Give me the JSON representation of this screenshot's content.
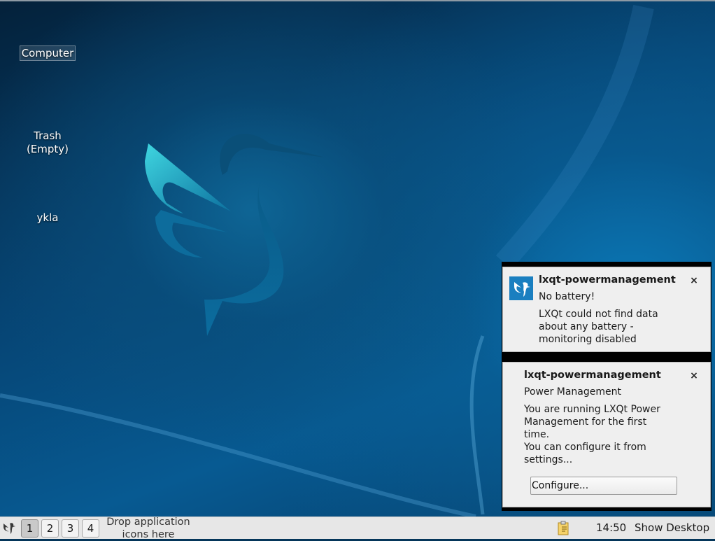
{
  "desktop": {
    "icons": [
      {
        "label": "Computer"
      },
      {
        "label_line1": "Trash",
        "label_line2": "(Empty)"
      },
      {
        "label": "ykla"
      }
    ]
  },
  "notifications": [
    {
      "app": "lxqt-powermanagement",
      "summary": "No battery!",
      "body_lines": [
        "LXQt could not find data",
        "about any battery -",
        "monitoring disabled"
      ],
      "close_label": "×"
    },
    {
      "app": "lxqt-powermanagement",
      "summary": "Power Management",
      "body_lines": [
        "You are running LXQt Power",
        "Management for the first",
        "time.",
        "You can configure it from",
        "settings..."
      ],
      "action_label": "Configure...",
      "close_label": "×"
    }
  ],
  "taskbar": {
    "workspaces": [
      "1",
      "2",
      "3",
      "4"
    ],
    "active_workspace": "1",
    "drop_hint_line1": "Drop application",
    "drop_hint_line2": "icons here",
    "clock": "14:50",
    "show_desktop_label": "Show Desktop",
    "menu_icon": "lxqt-bird-icon",
    "tray_icon": "clipboard-icon"
  },
  "colors": {
    "accent": "#1a7fc0",
    "panel_bg": "#e7e7e7",
    "notification_bg": "#efefef"
  }
}
